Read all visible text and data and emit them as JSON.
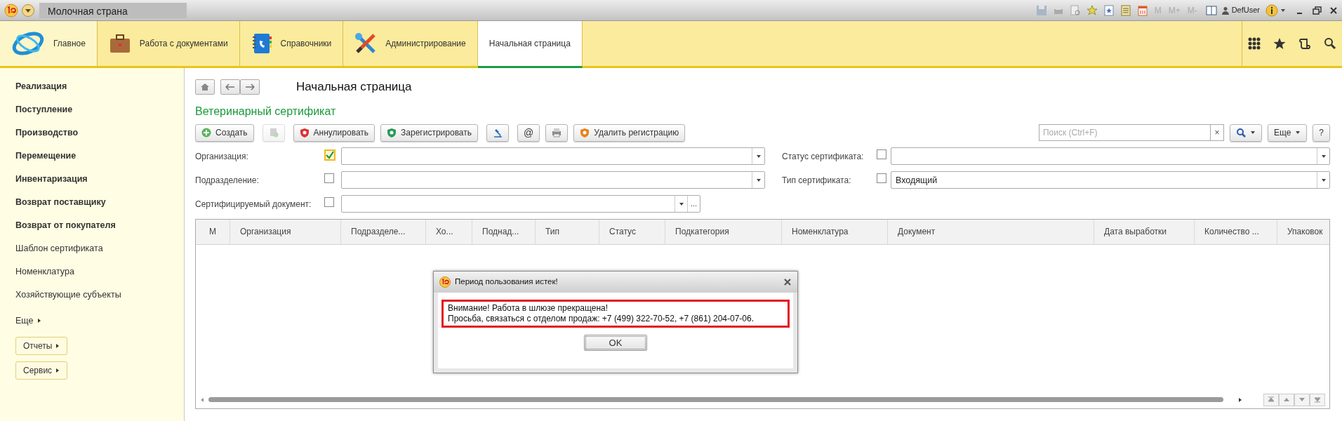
{
  "window": {
    "title": "Молочная страна"
  },
  "title_bar": {
    "memory_buttons": [
      "M",
      "M+",
      "M-"
    ],
    "user": "DefUser"
  },
  "sections": [
    {
      "label": "Главное",
      "selected": false
    },
    {
      "label": "Работа с документами",
      "selected": false
    },
    {
      "label": "Справочники",
      "selected": false
    },
    {
      "label": "Администрирование",
      "selected": false
    },
    {
      "label": "Начальная страница",
      "selected": true
    }
  ],
  "sidebar": {
    "items": [
      {
        "label": "Реализация",
        "emphasized": true
      },
      {
        "label": "Поступление",
        "emphasized": true
      },
      {
        "label": "Производство",
        "emphasized": true
      },
      {
        "label": "Перемещение",
        "emphasized": true
      },
      {
        "label": "Инвентаризация",
        "emphasized": true
      },
      {
        "label": "Возврат поставщику",
        "emphasized": true
      },
      {
        "label": "Возврат от покупателя",
        "emphasized": true
      },
      {
        "label": "Шаблон сертификата",
        "emphasized": false
      },
      {
        "label": "Номенклатура",
        "emphasized": false
      },
      {
        "label": "Хозяйствующие субъекты",
        "emphasized": false
      }
    ],
    "more": "Еще",
    "buttons": [
      "Отчеты",
      "Сервис"
    ]
  },
  "page": {
    "title": "Начальная страница"
  },
  "form": {
    "title": "Ветеринарный сертификат",
    "toolbar": [
      {
        "kind": "create",
        "label": "Создать",
        "disabled": false
      },
      {
        "kind": "copy",
        "disabled": true
      },
      {
        "kind": "annul",
        "label": "Аннулировать",
        "disabled": false
      },
      {
        "kind": "register",
        "label": "Зарегистрировать",
        "disabled": false
      },
      {
        "kind": "microscope",
        "disabled": false
      },
      {
        "kind": "text",
        "label": "@",
        "disabled": false
      },
      {
        "kind": "print",
        "disabled": false
      },
      {
        "kind": "unregister",
        "label": "Удалить регистрацию",
        "disabled": false
      }
    ],
    "search": {
      "placeholder": "Поиск (Ctrl+F)",
      "clear": "×"
    },
    "more_button": "Еще",
    "help_button": "?",
    "filters_left": [
      {
        "label": "Организация:",
        "checked": true,
        "focused": true
      },
      {
        "label": "Подразделение:",
        "checked": false,
        "focused": false
      },
      {
        "label": "Сертифицируемый документ:",
        "checked": false,
        "focused": false,
        "choice_button": "..."
      }
    ],
    "filters_right": [
      {
        "label": "Статус сертификата:",
        "checked": false,
        "focused": false
      },
      {
        "label": "Тип сертификата:",
        "checked": false,
        "focused": false,
        "value": "Входящий"
      }
    ],
    "table": {
      "columns": [
        "М",
        "Организация",
        "Подразделе...",
        "Хо...",
        "Поднад...",
        "Тип",
        "Статус",
        "Подкатегория",
        "Номенклатура",
        "Документ",
        "Дата выработки",
        "Количество ...",
        "Упаковок"
      ]
    }
  },
  "dialog": {
    "title": "Период пользования истек!",
    "message": [
      "Внимание! Работа в шлюзе прекращена!",
      "Просьба, связаться с отделом продаж: +7 (499) 322-70-52, +7 (861) 204-07-06."
    ],
    "highlighted": true,
    "button": "OK"
  }
}
